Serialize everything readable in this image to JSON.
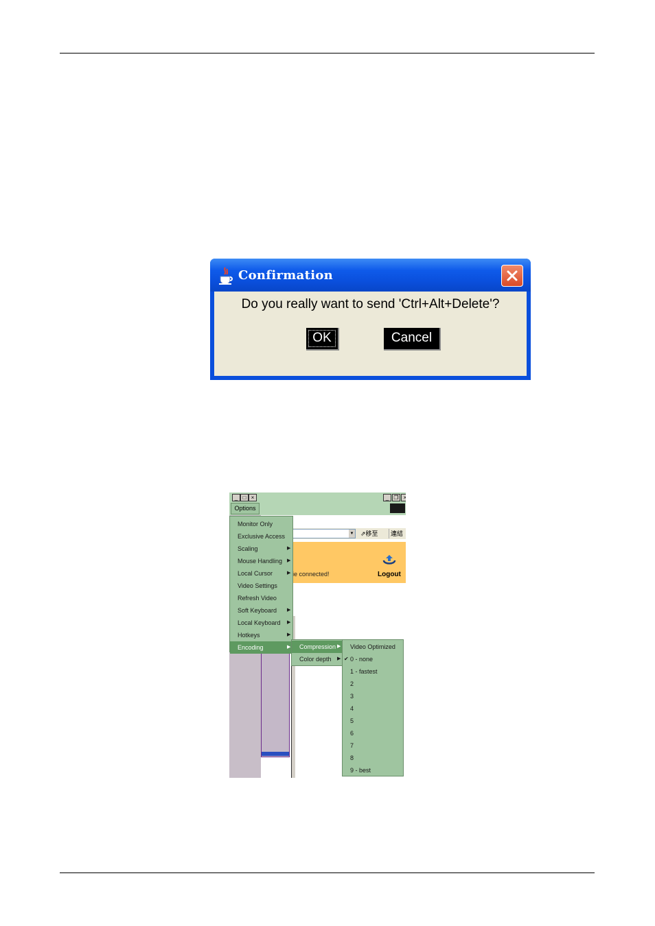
{
  "dialog": {
    "title": "Confirmation",
    "message": "Do you really want to send 'Ctrl+Alt+Delete'?",
    "ok_label": "OK",
    "cancel_label": "Cancel"
  },
  "viewer": {
    "options_label": "Options",
    "toolbar_go": "移至",
    "toolbar_link": "連結",
    "status_text": "ie connected!",
    "logout_label": "Logout",
    "options_menu": [
      {
        "label": "Monitor Only",
        "submenu": false
      },
      {
        "label": "Exclusive Access",
        "submenu": false
      },
      {
        "label": "Scaling",
        "submenu": true
      },
      {
        "label": "Mouse Handling",
        "submenu": true
      },
      {
        "label": "Local Cursor",
        "submenu": true
      },
      {
        "label": "Video Settings",
        "submenu": false
      },
      {
        "label": "Refresh Video",
        "submenu": false
      },
      {
        "label": "Soft Keyboard",
        "submenu": true
      },
      {
        "label": "Local Keyboard",
        "submenu": true
      },
      {
        "label": "Hotkeys",
        "submenu": true
      },
      {
        "label": "Encoding",
        "submenu": true
      }
    ],
    "encoding_menu": [
      {
        "label": "Compression",
        "submenu": true
      },
      {
        "label": "Color depth",
        "submenu": true
      }
    ],
    "compression_menu": [
      {
        "label": "Video Optimized",
        "checked": false
      },
      {
        "label": "0 - none",
        "checked": true
      },
      {
        "label": "1 - fastest",
        "checked": false
      },
      {
        "label": "2",
        "checked": false
      },
      {
        "label": "3",
        "checked": false
      },
      {
        "label": "4",
        "checked": false
      },
      {
        "label": "5",
        "checked": false
      },
      {
        "label": "6",
        "checked": false
      },
      {
        "label": "7",
        "checked": false
      },
      {
        "label": "8",
        "checked": false
      },
      {
        "label": "9 - best",
        "checked": false
      }
    ]
  }
}
